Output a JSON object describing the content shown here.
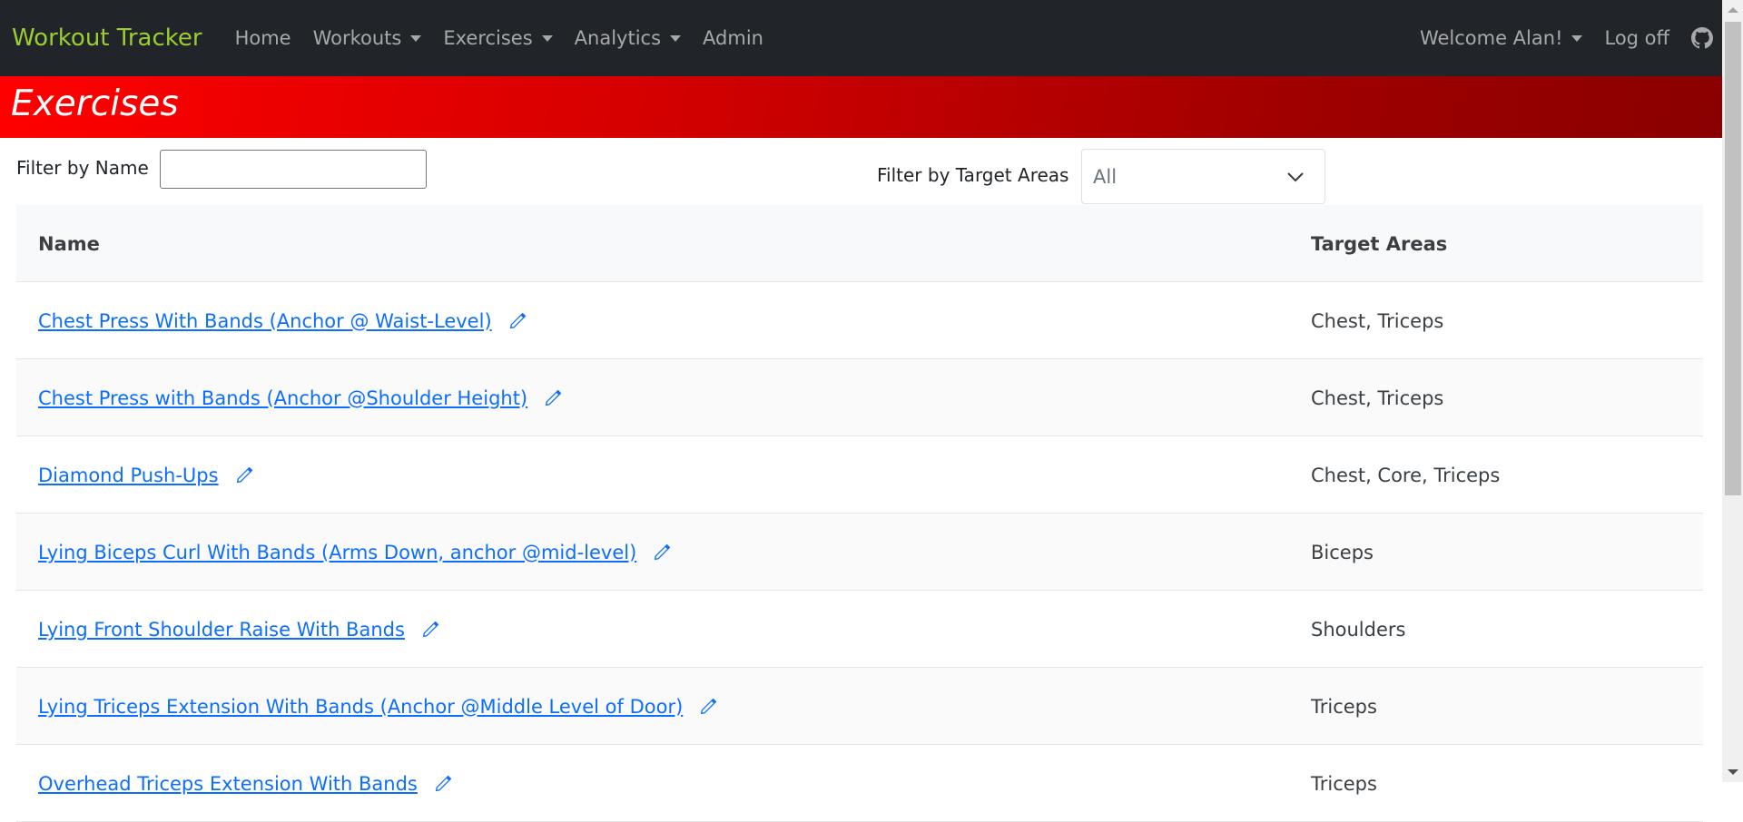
{
  "nav": {
    "brand": "Workout Tracker",
    "items": [
      {
        "label": "Home",
        "dropdown": false
      },
      {
        "label": "Workouts",
        "dropdown": true
      },
      {
        "label": "Exercises",
        "dropdown": true
      },
      {
        "label": "Analytics",
        "dropdown": true
      },
      {
        "label": "Admin",
        "dropdown": false
      }
    ],
    "user_menu": "Welcome Alan!",
    "logoff": "Log off",
    "github_icon": "github-icon"
  },
  "page": {
    "title": "Exercises"
  },
  "filters": {
    "name_label": "Filter by Name",
    "name_value": "",
    "target_label": "Filter by Target Areas",
    "target_selected": "All"
  },
  "table": {
    "headers": [
      "Name",
      "Target Areas"
    ],
    "rows": [
      {
        "name": "Chest Press With Bands (Anchor @ Waist-Level)",
        "targets": "Chest, Triceps"
      },
      {
        "name": "Chest Press with Bands (Anchor @Shoulder Height)",
        "targets": "Chest, Triceps"
      },
      {
        "name": "Diamond Push-Ups",
        "targets": "Chest, Core, Triceps"
      },
      {
        "name": "Lying Biceps Curl With Bands (Arms Down, anchor @mid-level)",
        "targets": "Biceps"
      },
      {
        "name": "Lying Front Shoulder Raise With Bands",
        "targets": "Shoulders"
      },
      {
        "name": "Lying Triceps Extension With Bands (Anchor @Middle Level of Door)",
        "targets": "Triceps"
      },
      {
        "name": "Overhead Triceps Extension With Bands",
        "targets": "Triceps"
      }
    ]
  },
  "colors": {
    "navbar_bg": "#212529",
    "brand": "#9acd32",
    "link": "#0d6efd",
    "banner_start": "#ff0000",
    "banner_end": "#8a0000"
  }
}
